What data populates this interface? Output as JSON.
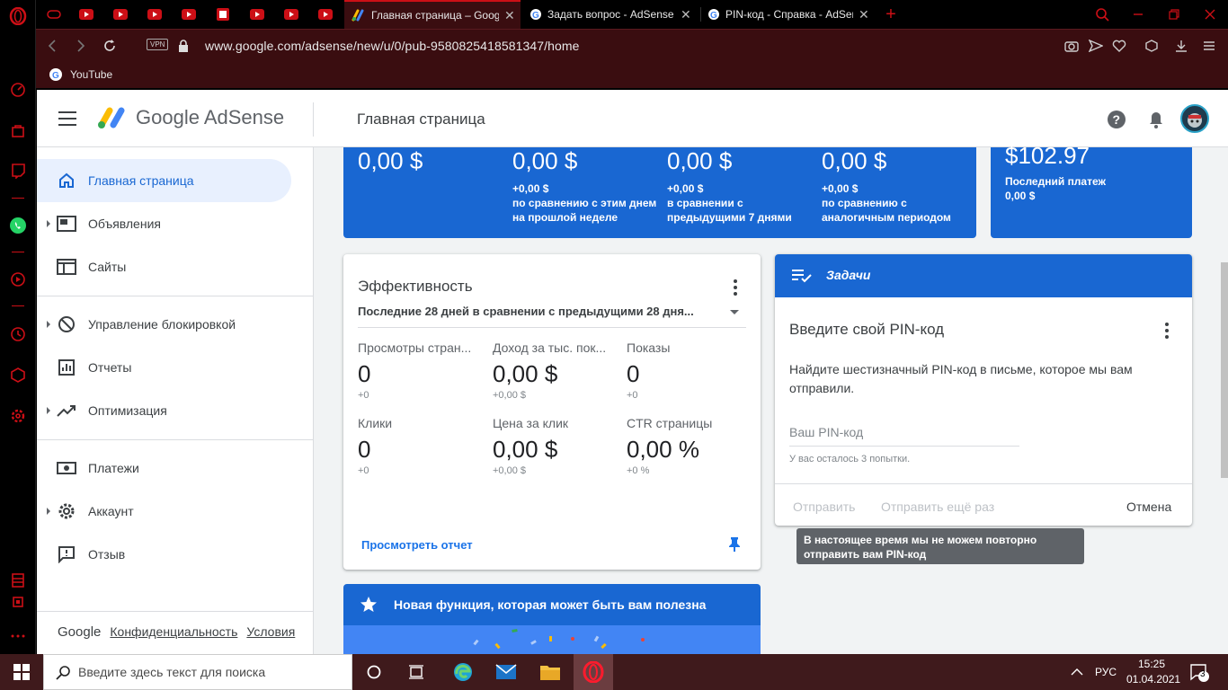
{
  "browser": {
    "tabs": [
      {
        "label": "Главная страница – Google AdSense",
        "active": true
      },
      {
        "label": "Задать вопрос - AdSense Community",
        "active": false
      },
      {
        "label": "PIN-код - Справка - AdSense",
        "active": false
      }
    ],
    "url": "www.google.com/adsense/new/u/0/pub-9580825418581347/home",
    "vpn_label": "VPN",
    "bookmark": "YouTube",
    "accent": "#cc0f16"
  },
  "header": {
    "logo_text": "Google AdSense",
    "page_title": "Главная страница"
  },
  "nav": {
    "items": [
      {
        "label": "Главная страница",
        "active": true
      },
      {
        "label": "Объявления"
      },
      {
        "label": "Сайты"
      },
      {
        "label": "Управление блокировкой"
      },
      {
        "label": "Отчеты"
      },
      {
        "label": "Оптимизация"
      },
      {
        "label": "Платежи"
      },
      {
        "label": "Аккаунт"
      },
      {
        "label": "Отзыв"
      }
    ],
    "footer": {
      "google": "Google",
      "privacy": "Конфиденциальность",
      "terms": "Условия"
    }
  },
  "summary": {
    "cols": [
      {
        "value": "0,00 $",
        "delta": "",
        "compare": ""
      },
      {
        "value": "0,00 $",
        "delta": "+0,00 $",
        "compare": "по сравнению с этим днем на прошлой неделе"
      },
      {
        "value": "0,00 $",
        "delta": "+0,00 $",
        "compare": "в сравнении с предыдущими 7 днями"
      },
      {
        "value": "0,00 $",
        "delta": "+0,00 $",
        "compare": "по сравнению с аналогичным периодом"
      }
    ],
    "balance": {
      "value": "$102.97",
      "label": "Последний платеж",
      "amount": "0,00 $"
    }
  },
  "performance": {
    "title": "Эффективность",
    "range": "Последние 28 дней в сравнении с предыдущими 28 дня...",
    "metrics": [
      {
        "label": "Просмотры стран...",
        "value": "0",
        "delta": "+0"
      },
      {
        "label": "Доход за тыс. пок...",
        "value": "0,00 $",
        "delta": "+0,00 $"
      },
      {
        "label": "Показы",
        "value": "0",
        "delta": "+0"
      },
      {
        "label": "Клики",
        "value": "0",
        "delta": "+0"
      },
      {
        "label": "Цена за клик",
        "value": "0,00 $",
        "delta": "+0,00 $"
      },
      {
        "label": "CTR страницы",
        "value": "0,00 %",
        "delta": "+0 %"
      }
    ],
    "view_report": "Просмотреть отчет"
  },
  "tasks": {
    "header": "Задачи",
    "title": "Введите свой PIN-код",
    "description": "Найдите шестизначный PIN-код в письме, которое мы вам отправили.",
    "input_placeholder": "Ваш PIN-код",
    "attempts": "У вас осталось 3 попытки.",
    "send": "Отправить",
    "resend": "Отправить ещё раз",
    "cancel": "Отмена",
    "tooltip": "В настоящее время мы не можем повторно отправить вам PIN-код"
  },
  "feature": {
    "title": "Новая функция, которая может быть вам полезна"
  },
  "taskbar": {
    "search_placeholder": "Введите здесь текст для поиска",
    "lang": "РУС",
    "time": "15:25",
    "date": "01.04.2021",
    "notifications": "3"
  }
}
